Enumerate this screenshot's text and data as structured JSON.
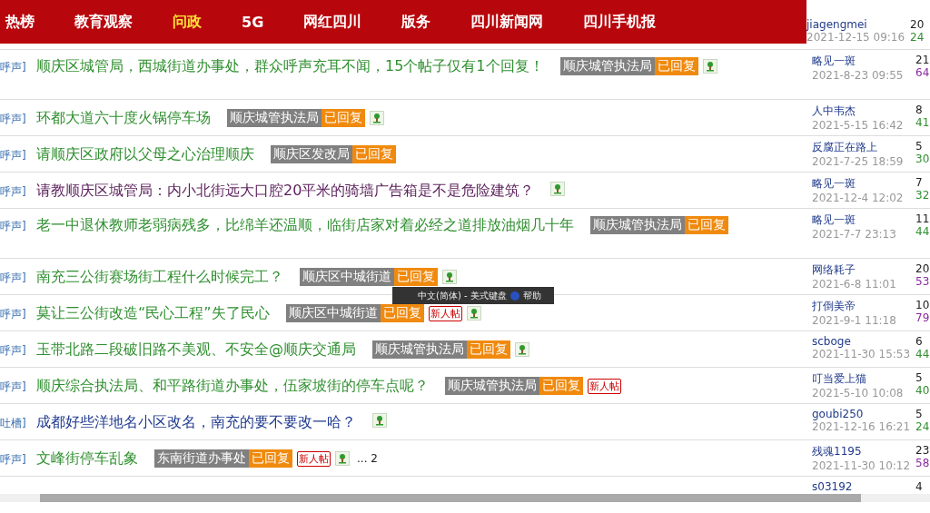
{
  "nav": [
    {
      "label": "热榜",
      "selected": false
    },
    {
      "label": "教育观察",
      "selected": false
    },
    {
      "label": "问政",
      "selected": true
    },
    {
      "label": "5G",
      "selected": false
    },
    {
      "label": "网红四川",
      "selected": false
    },
    {
      "label": "版务",
      "selected": false
    },
    {
      "label": "四川新闻网",
      "selected": false
    },
    {
      "label": "四川手机报",
      "selected": false
    }
  ],
  "top_row": {
    "author": "jiagengmei",
    "date": "2021-12-15 09:16",
    "replies": "20",
    "views": {
      "text": "24",
      "color": "#2f8f2f"
    }
  },
  "rows": [
    {
      "prefix": "呼声]",
      "title": {
        "text": "顺庆区城管局，西城街道办事处，群众呼声充耳不闻，15个帖子仅有1个回复！",
        "color": "#2f8f2f"
      },
      "tags": [
        {
          "kind": "dept",
          "text": "顺庆城管执法局"
        },
        {
          "kind": "replied",
          "text": "已回复"
        },
        {
          "kind": "image"
        }
      ],
      "author": "略见一斑",
      "date": "2021-8-23 09:55",
      "replies": "21",
      "views": {
        "text": "64",
        "color": "#8a2aa0"
      }
    },
    {
      "prefix": "呼声]",
      "title": {
        "text": "环都大道六十度火锅停车场",
        "color": "#2f8f2f"
      },
      "tags": [
        {
          "kind": "dept",
          "text": "顺庆城管执法局"
        },
        {
          "kind": "replied",
          "text": "已回复"
        },
        {
          "kind": "image"
        }
      ],
      "author": "人中韦杰",
      "date": "2021-5-15 16:42",
      "replies": "8",
      "views": {
        "text": "41",
        "color": "#2f8f2f"
      }
    },
    {
      "prefix": "呼声]",
      "title": {
        "text": "请顺庆区政府以父母之心治理顺庆",
        "color": "#2f8f2f"
      },
      "tags": [
        {
          "kind": "dept",
          "text": "顺庆区发改局"
        },
        {
          "kind": "replied",
          "text": "已回复"
        }
      ],
      "author": "反腐正在路上",
      "date": "2021-7-25 18:59",
      "replies": "5",
      "views": {
        "text": "30",
        "color": "#2f8f2f"
      }
    },
    {
      "prefix": "呼声]",
      "title": {
        "text": "请教顺庆区城管局：内小北街远大口腔20平米的骑墙广告箱是不是危险建筑？",
        "color": "#5a1f5a"
      },
      "tags": [
        {
          "kind": "image"
        }
      ],
      "author": "略见一斑",
      "date": "2021-12-4 12:02",
      "replies": "7",
      "views": {
        "text": "32",
        "color": "#2f8f2f"
      }
    },
    {
      "prefix": "呼声]",
      "title": {
        "text": "老一中退休教师老弱病残多，比绵羊还温顺，临街店家对着必经之道排放油烟几十年",
        "color": "#2f8f2f"
      },
      "tags": [
        {
          "kind": "dept",
          "text": "顺庆城管执法局"
        },
        {
          "kind": "replied",
          "text": "已回复"
        }
      ],
      "author": "略见一斑",
      "date": "2021-7-7 23:13",
      "replies": "11",
      "views": {
        "text": "44",
        "color": "#2f8f2f"
      }
    },
    {
      "prefix": "呼声]",
      "title": {
        "text": "南充三公街赛场街工程什么时候完工？",
        "color": "#2f8f2f"
      },
      "tags": [
        {
          "kind": "dept",
          "text": "顺庆区中城街道"
        },
        {
          "kind": "replied",
          "text": "已回复"
        },
        {
          "kind": "image"
        }
      ],
      "author": "网络耗子",
      "date": "2021-6-8 11:01",
      "replies": "20",
      "views": {
        "text": "53",
        "color": "#8a2aa0"
      }
    },
    {
      "prefix": "呼声]",
      "title": {
        "text": "莫让三公街改造“民心工程”失了民心",
        "color": "#2f8f2f"
      },
      "tags": [
        {
          "kind": "dept",
          "text": "顺庆区中城街道"
        },
        {
          "kind": "replied",
          "text": "已回复"
        },
        {
          "kind": "new",
          "text": "新人帖"
        },
        {
          "kind": "image"
        }
      ],
      "author": "打倒美帝",
      "date": "2021-9-1 11:18",
      "replies": "10",
      "views": {
        "text": "79",
        "color": "#8a2aa0"
      }
    },
    {
      "prefix": "呼声]",
      "title": {
        "text": "玉带北路二段破旧路不美观、不安全@顺庆交通局",
        "color": "#2f8f2f"
      },
      "tags": [
        {
          "kind": "dept",
          "text": "顺庆城管执法局"
        },
        {
          "kind": "replied",
          "text": "已回复"
        },
        {
          "kind": "image"
        }
      ],
      "author": "scboge",
      "date": "2021-11-30 15:53",
      "replies": "6",
      "views": {
        "text": "44",
        "color": "#2f8f2f"
      }
    },
    {
      "prefix": "呼声]",
      "title": {
        "text": "顺庆综合执法局、和平路街道办事处，伍家坡街的停车点呢？",
        "color": "#2f8f2f"
      },
      "tags": [
        {
          "kind": "dept",
          "text": "顺庆城管执法局"
        },
        {
          "kind": "replied",
          "text": "已回复"
        },
        {
          "kind": "new",
          "text": "新人帖"
        }
      ],
      "author": "叮当爱上猫",
      "date": "2021-5-10 10:08",
      "replies": "5",
      "views": {
        "text": "40",
        "color": "#2f8f2f"
      }
    },
    {
      "prefix": "吐槽]",
      "title": {
        "text": "成都好些洋地名小区改名，南充的要不要改一哈？",
        "color": "#1f3a8f"
      },
      "tags": [
        {
          "kind": "image"
        }
      ],
      "author": "goubi250",
      "date": "2021-12-16 16:21",
      "replies": "5",
      "views": {
        "text": "24",
        "color": "#2f8f2f"
      }
    },
    {
      "prefix": "呼声]",
      "title": {
        "text": "文峰街停车乱象",
        "color": "#2f8f2f"
      },
      "tags": [
        {
          "kind": "dept",
          "text": "东南街道办事处"
        },
        {
          "kind": "replied",
          "text": "已回复"
        },
        {
          "kind": "new",
          "text": "新人帖"
        },
        {
          "kind": "image"
        },
        {
          "kind": "pages",
          "text": "... 2"
        }
      ],
      "author": "残魂1195",
      "date": "2021-11-30 10:12",
      "replies": "23",
      "views": {
        "text": "58",
        "color": "#8a2aa0"
      }
    }
  ],
  "partial_row": {
    "author": "s03192",
    "replies": "4"
  },
  "ime_bar": {
    "label": "中文(简体) - 美式键盘",
    "help": "帮助"
  }
}
